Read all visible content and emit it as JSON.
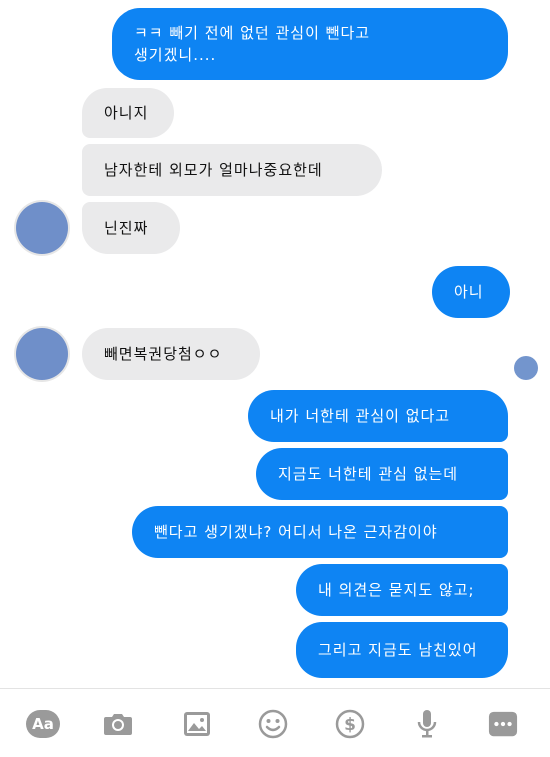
{
  "messages": [
    {
      "side": "out",
      "text": "ㅋㅋ 빼기 전에 없던 관심이 뺀다고\n생기겠니...."
    },
    {
      "side": "in",
      "text": "아니지"
    },
    {
      "side": "in",
      "text": "남자한테 외모가 얼마나중요한데"
    },
    {
      "side": "in",
      "text": "닌진짜"
    },
    {
      "side": "out",
      "text": "아니"
    },
    {
      "side": "in",
      "text": "빼면복권당첨ㅇㅇ"
    },
    {
      "side": "out",
      "text": "내가 너한테 관심이 없다고"
    },
    {
      "side": "out",
      "text": "지금도 너한테 관심 없는데"
    },
    {
      "side": "out",
      "text": "뺀다고 생기겠냐? 어디서 나온 근자감이야"
    },
    {
      "side": "out",
      "text": "내 의견은 묻지도 않고;"
    },
    {
      "side": "out",
      "text": "그리고 지금도 남친있어"
    }
  ],
  "toolbar": {
    "aa_label": "Aa",
    "icons": [
      "font-size-icon",
      "camera-icon",
      "image-icon",
      "emoji-icon",
      "payment-icon",
      "microphone-icon",
      "more-icon"
    ]
  },
  "colors": {
    "outgoing_bubble": "#0e84f3",
    "incoming_bubble": "#eaeaeb",
    "avatar": "#6f8fc9"
  }
}
